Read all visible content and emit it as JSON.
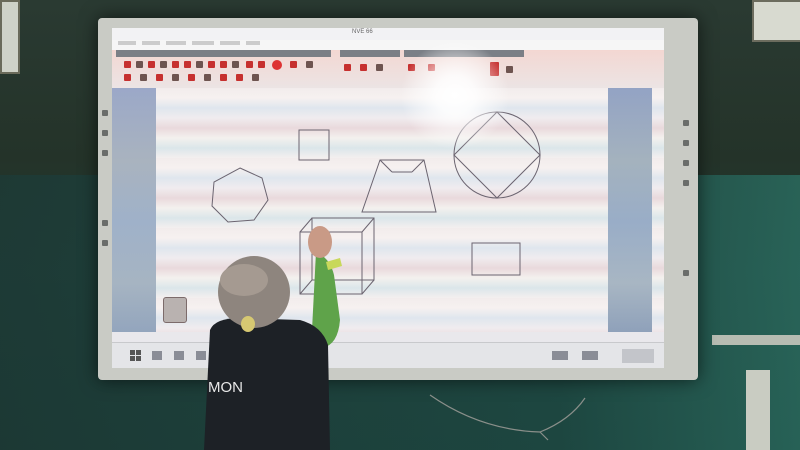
{
  "scene": {
    "description_tags": [
      "interactive-whiteboard",
      "classroom",
      "child-drawing"
    ],
    "colors": {
      "wall": "#243329",
      "board_frame": "#c9cbc5",
      "canvas_stripes": [
        "#f2ecec",
        "#dfe6ee",
        "#e9d9dc"
      ],
      "toolbar_accent": "#c6302f",
      "shirt": "#1d2126",
      "sleeve": "#5fa34a"
    }
  },
  "screen": {
    "app_title": "NVE 66",
    "canvas_shapes": [
      "square",
      "heptagon",
      "truncated-pyramid",
      "circle-with-inscribed-square",
      "cuboid",
      "rectangle"
    ]
  },
  "icons": {
    "start": "windows-start-icon",
    "pen_holder": "pen-holder-icon",
    "toolbar_tools": "drawing-tool-icon"
  },
  "shirt_text": "MON"
}
